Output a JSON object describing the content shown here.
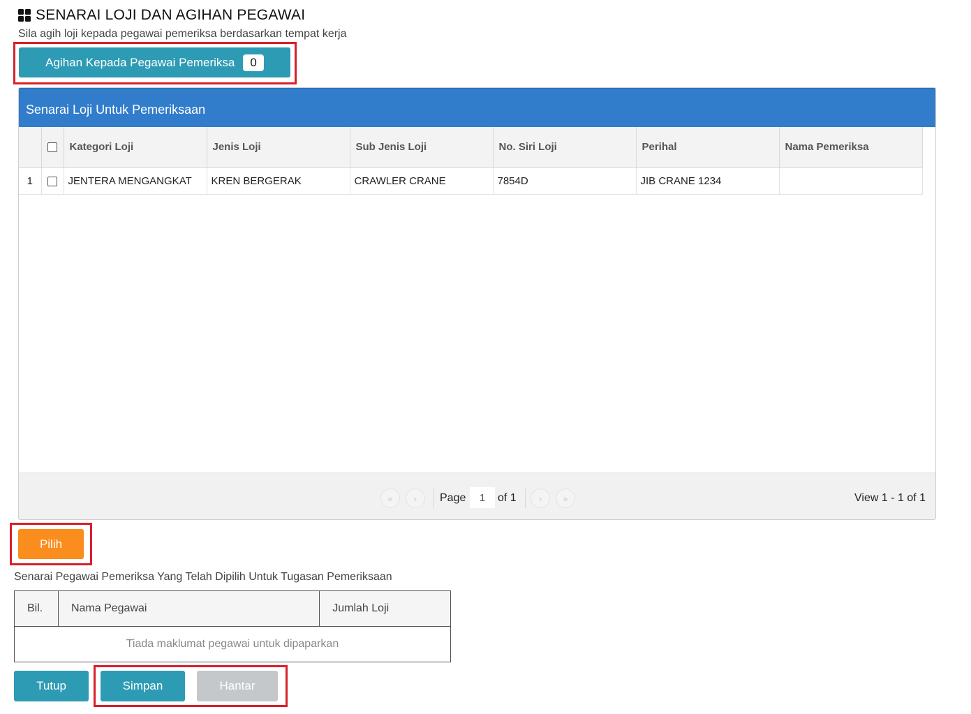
{
  "page": {
    "title": "SENARAI LOJI DAN AGIHAN PEGAWAI",
    "subtitle": "Sila agih loji kepada pegawai pemeriksa berdasarkan tempat kerja"
  },
  "assign_button": {
    "label": "Agihan Kepada Pegawai Pemeriksa",
    "count": "0"
  },
  "plant_panel": {
    "title": "Senarai Loji Untuk Pemeriksaan",
    "columns": [
      "Kategori Loji",
      "Jenis Loji",
      "Sub Jenis Loji",
      "No. Siri Loji",
      "Perihal",
      "Nama Pemeriksa"
    ],
    "rows": [
      {
        "num": "1",
        "kategori": "JENTERA MENGANGKAT",
        "jenis": "KREN BERGERAK",
        "sub_jenis": "CRAWLER CRANE",
        "no_siri": "7854D",
        "perihal": "JIB CRANE 1234",
        "pemeriksa": ""
      }
    ]
  },
  "pager": {
    "first_icon": "double-chevron-left-icon",
    "prev_icon": "chevron-left-icon",
    "next_icon": "chevron-right-icon",
    "last_icon": "double-chevron-right-icon",
    "page_label": "Page",
    "current_page": "1",
    "of_label": "of 1",
    "view_label": "View 1 - 1 of 1"
  },
  "select_button": {
    "label": "Pilih"
  },
  "officer_section": {
    "label": "Senarai Pegawai Pemeriksa Yang Telah Dipilih Untuk Tugasan Pemeriksaan",
    "columns": [
      "Bil.",
      "Nama Pegawai",
      "Jumlah Loji"
    ],
    "empty_message": "Tiada maklumat pegawai untuk dipaparkan"
  },
  "footer": {
    "close_label": "Tutup",
    "save_label": "Simpan",
    "submit_label": "Hantar"
  },
  "colors": {
    "accent_blue": "#317dcb",
    "teal": "#2e9bb5",
    "orange": "#fb8c1e",
    "highlight_red": "#d9202a"
  }
}
